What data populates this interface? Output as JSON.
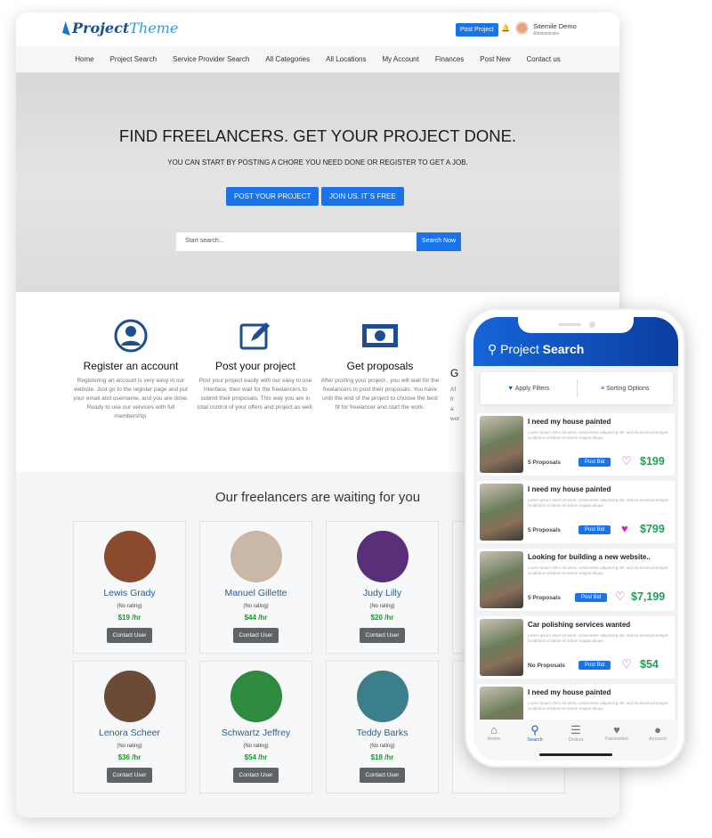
{
  "header": {
    "logo": "Project",
    "logo2": "Theme",
    "post_project": "Post Project",
    "user_name": "Sitemile Demo",
    "user_role": "Administrator"
  },
  "nav": [
    "Home",
    "Project Search",
    "Service Provider Search",
    "All Categories",
    "All Locations",
    "My Account",
    "Finances",
    "Post New",
    "Contact us"
  ],
  "hero": {
    "title": "FIND FREELANCERS. GET YOUR PROJECT DONE.",
    "subtitle": "YOU CAN START BY POSTING A CHORE YOU NEED DONE OR REGISTER TO GET A JOB.",
    "btn_post": "POST YOUR PROJECT",
    "btn_join": "JOIN US. IT`S FREE",
    "search_placeholder": "Start search...",
    "search_btn": "Search Now"
  },
  "steps": [
    {
      "title": "Register an account",
      "text": "Registering an account is very easy in our website. Just go to the register page and put your email and username, and you are done. Ready to use our services with full membership.",
      "icon": "user-circle-icon"
    },
    {
      "title": "Post your project",
      "text": "Post your project easily with our easy to use interface, then wait for the freelancers to submit their proposals. This way you are in total control of your offers and project as well.",
      "icon": "edit-icon"
    },
    {
      "title": "Get proposals",
      "text": "After posting your project , you will wait for the freelancers to post their proposals. You have until the end of the project to choose the best fit for freelancer and start the work.",
      "icon": "money-icon"
    },
    {
      "title": "G",
      "text": "Af fr a wor"
    }
  ],
  "freelancers": {
    "title": "Our freelancers are waiting for you",
    "contact_label": "Contact User",
    "items": [
      {
        "name": "Lewis Grady",
        "rating": "(No rating)",
        "rate": "$19 /hr",
        "color": "#8a4a2e"
      },
      {
        "name": "Manuel Gillette",
        "rating": "(No rating)",
        "rate": "$44 /hr",
        "color": "#c9b8a8"
      },
      {
        "name": "Judy Lilly",
        "rating": "(No rating)",
        "rate": "$20 /hr",
        "color": "#5a2f7a"
      },
      {
        "name": "",
        "rating": "",
        "rate": "",
        "color": "#f7f8f9"
      },
      {
        "name": "Lenora Scheer",
        "rating": "(No rating)",
        "rate": "$36 /hr",
        "color": "#6b4a36"
      },
      {
        "name": "Schwartz Jeffrey",
        "rating": "(No rating)",
        "rate": "$54 /hr",
        "color": "#2e8a3e"
      },
      {
        "name": "Teddy Barks",
        "rating": "(No rating)",
        "rate": "$18 /hr",
        "color": "#3a7f8a"
      },
      {
        "name": "",
        "rating": "",
        "rate": "",
        "color": "#f7f8f9"
      }
    ]
  },
  "phone": {
    "title_a": "Project",
    "title_b": "Search",
    "apply_filters": "Apply Filters",
    "sorting": "Sorting Options",
    "post_bid": "Post Bid",
    "desc": "Lorem ipsum dolor sit amet, consectetur adipiscing elit, sed do eiusmod tempor incididunt ut labore et dolore magna aliqua",
    "projects": [
      {
        "title": "I need my house painted",
        "proposals": "5 Proposals",
        "price": "$199",
        "favorite": false
      },
      {
        "title": "I need my house painted",
        "proposals": "5 Proposals",
        "price": "$799",
        "favorite": true
      },
      {
        "title": "Looking for building a new website..",
        "proposals": "5 Proposals",
        "price": "$7,199",
        "favorite": false
      },
      {
        "title": "Car polishing services wanted",
        "proposals": "No Proposals",
        "price": "$54",
        "favorite": false
      },
      {
        "title": "I need my house painted",
        "proposals": "",
        "price": "",
        "favorite": false
      }
    ],
    "tabs": [
      {
        "label": "Home",
        "icon": "home-icon"
      },
      {
        "label": "Search",
        "icon": "search-icon",
        "active": true
      },
      {
        "label": "Orders",
        "icon": "layers-icon"
      },
      {
        "label": "Favourites",
        "icon": "heart-icon"
      },
      {
        "label": "Account",
        "icon": "user-icon"
      }
    ]
  },
  "colors": {
    "accent": "#1a73e8",
    "price": "#22a05a",
    "heart": "#d526b5",
    "icon": "#1b4f8f"
  }
}
